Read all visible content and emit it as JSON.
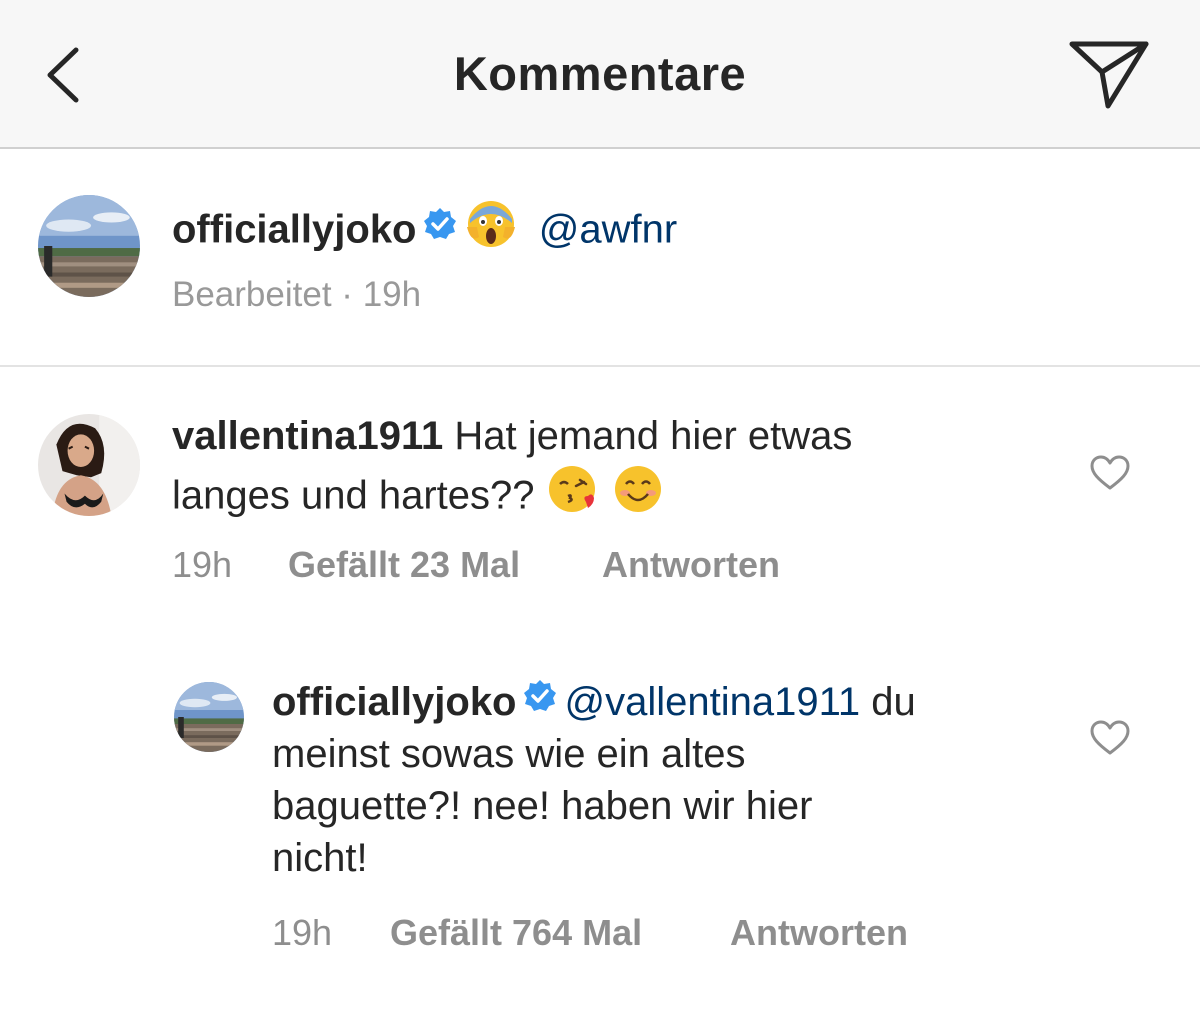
{
  "header": {
    "title": "Kommentare",
    "back_icon": "chevron-left-icon",
    "send_icon": "paper-plane-icon"
  },
  "caption": {
    "username": "officiallyjoko",
    "verified_icon": "verified-badge-icon",
    "emoji": "face-screaming-in-fear-emoji",
    "mention": "@awfnr",
    "edited": "Bearbeitet",
    "separator": "·",
    "time": "19h"
  },
  "comments": [
    {
      "username": "vallentina1911",
      "text_line1": "Hat jemand hier etwas",
      "text_line2": "langes und hartes??",
      "emojis": [
        "face-blowing-kiss-emoji",
        "smiling-face-emoji"
      ],
      "time": "19h",
      "likes": "Gefällt 23 Mal",
      "reply": "Antworten"
    },
    {
      "username": "officiallyjoko",
      "verified_icon": "verified-badge-icon",
      "mention": "@vallentina1911",
      "text_line1_rest": "du",
      "text_line2": "meinst sowas wie ein altes",
      "text_line3": "baguette?! nee! haben wir hier",
      "text_line4": "nicht!",
      "time": "19h",
      "likes": "Gefällt 764 Mal",
      "reply": "Antworten"
    }
  ],
  "colors": {
    "header_bg": "#f7f7f7",
    "text": "#262626",
    "meta": "#8e8e8e",
    "mention": "#003569",
    "verified": "#3897f0"
  }
}
